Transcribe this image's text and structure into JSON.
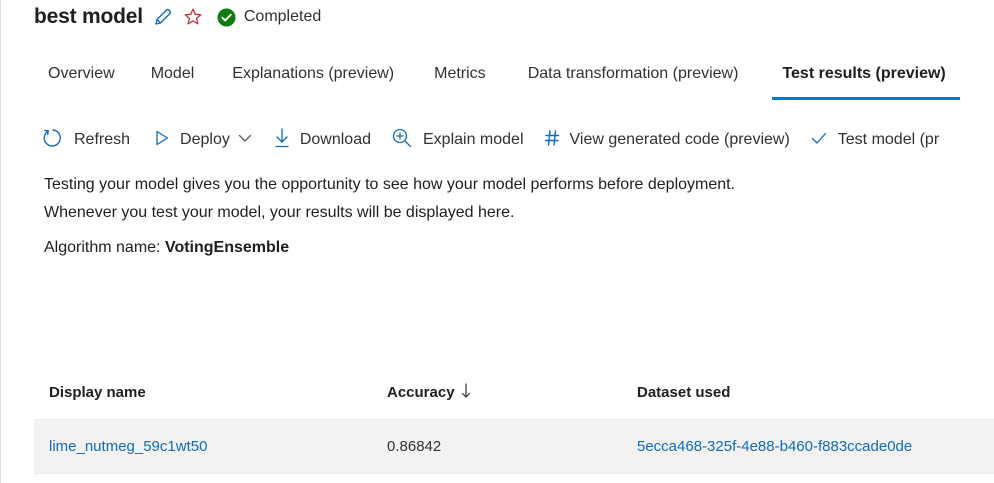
{
  "header": {
    "title": "best model",
    "status": "Completed",
    "icons": {
      "edit": "pencil-icon",
      "favorite": "star-icon",
      "status": "check-circle-icon"
    }
  },
  "tabs": [
    {
      "label": "Overview",
      "active": false
    },
    {
      "label": "Model",
      "active": false
    },
    {
      "label": "Explanations (preview)",
      "active": false
    },
    {
      "label": "Metrics",
      "active": false
    },
    {
      "label": "Data transformation (preview)",
      "active": false
    },
    {
      "label": "Test results (preview)",
      "active": true
    }
  ],
  "toolbar": {
    "refresh": "Refresh",
    "deploy": "Deploy",
    "download": "Download",
    "explain": "Explain model",
    "view_code": "View generated code (preview)",
    "test_model": "Test model (pr"
  },
  "description": {
    "line1": "Testing your model gives you the opportunity to see how your model performs before deployment.",
    "line2": "Whenever you test your model, your results will be displayed here."
  },
  "algorithm": {
    "label": "Algorithm name:",
    "value": "VotingEnsemble"
  },
  "table": {
    "columns": [
      "Display name",
      "Accuracy",
      "Dataset used"
    ],
    "rows": [
      {
        "display_name": "lime_nutmeg_59c1wt50",
        "accuracy": "0.86842",
        "dataset": "5ecca468-325f-4e88-b460-f883ccade0de"
      }
    ]
  },
  "colors": {
    "accent": "#0078d4",
    "link": "#0f6cbd",
    "success": "#107c10",
    "favorite": "#c4314b"
  }
}
